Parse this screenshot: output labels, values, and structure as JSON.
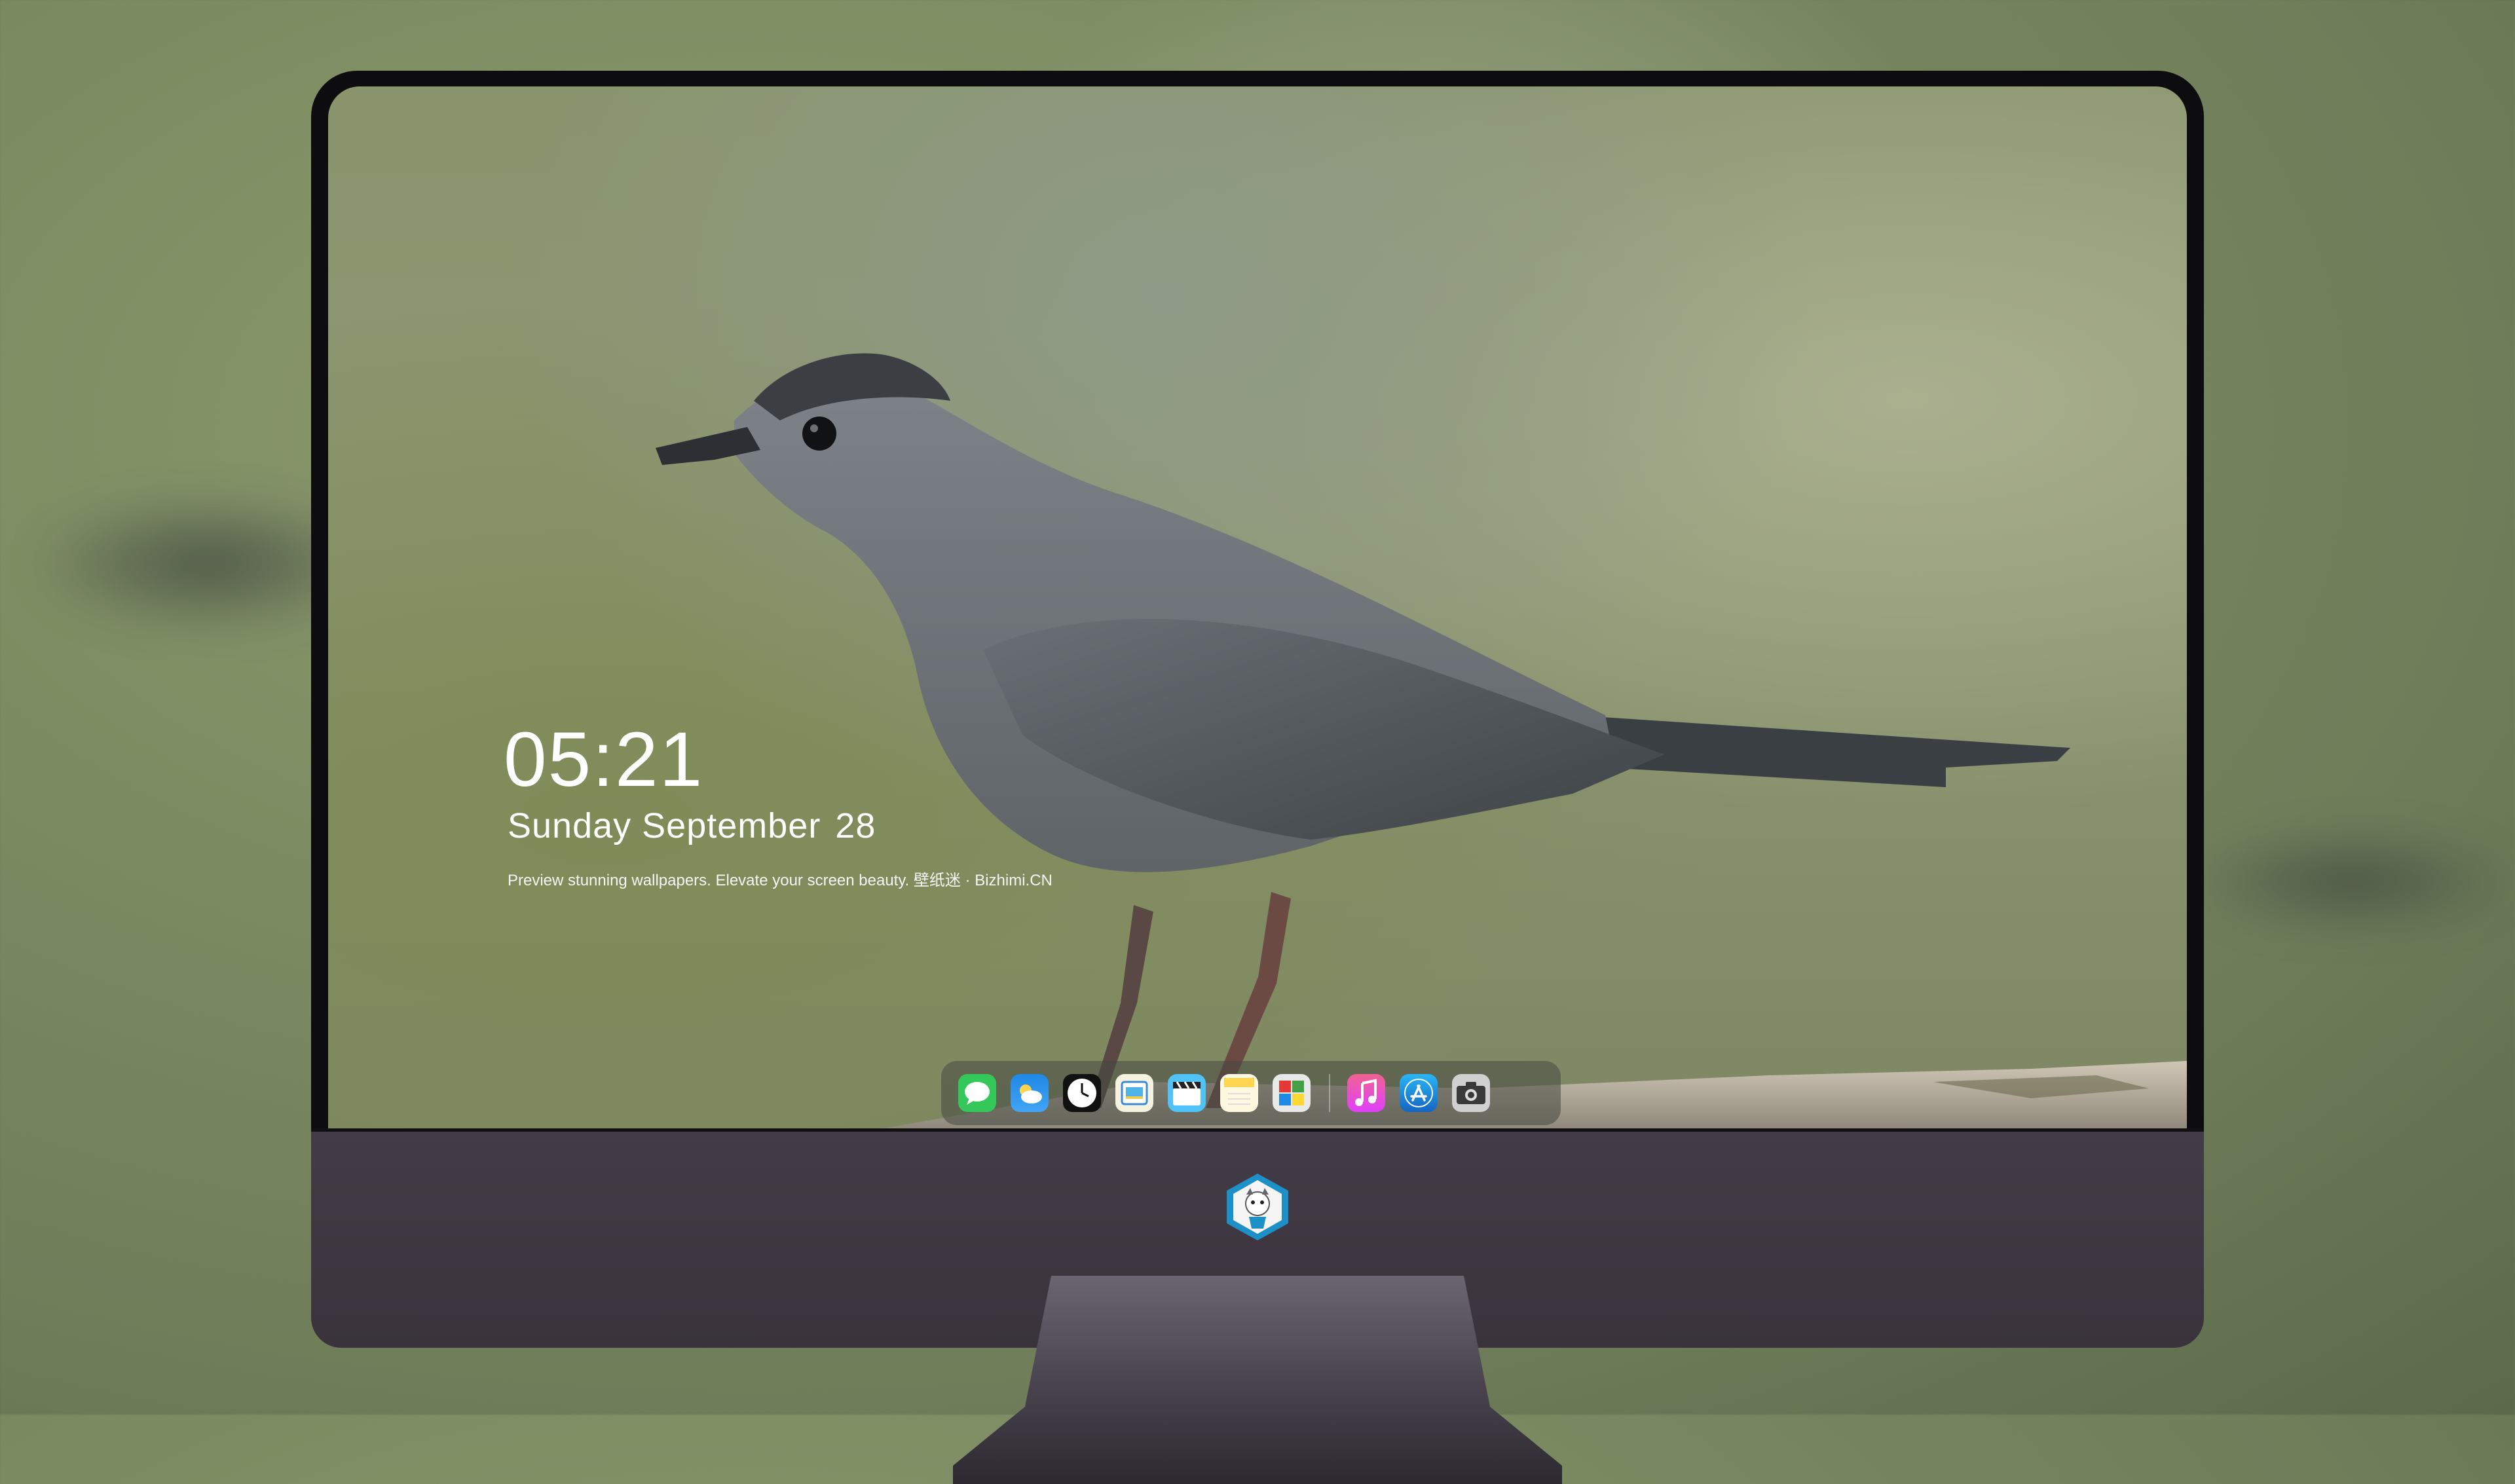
{
  "lockscreen": {
    "time": "05:21",
    "day_month": "Sunday September",
    "day_number": "28",
    "tagline": "Preview stunning wallpapers. Elevate your screen beauty. 壁纸迷 · Bizhimi.CN"
  },
  "dock": {
    "apps": [
      {
        "name": "Messages",
        "icon": "messages-icon",
        "color": "#34c759"
      },
      {
        "name": "Weather",
        "icon": "weather-icon",
        "color": "#1e88e5"
      },
      {
        "name": "Clock",
        "icon": "clock-icon",
        "color": "#111111"
      },
      {
        "name": "Preview",
        "icon": "preview-icon",
        "color": "#f2c94c"
      },
      {
        "name": "Clips",
        "icon": "clapperboard-icon",
        "color": "#4fc3f7"
      },
      {
        "name": "Notes",
        "icon": "notes-icon",
        "color": "#ffd54f"
      },
      {
        "name": "Photo Booth",
        "icon": "photo-grid-icon",
        "color": "#e0e0e0"
      },
      {
        "name": "iTunes",
        "icon": "music-icon",
        "color": "#e040fb"
      },
      {
        "name": "App Store",
        "icon": "app-store-icon",
        "color": "#1e88e5"
      },
      {
        "name": "Camera",
        "icon": "camera-icon",
        "color": "#5f5f5f"
      }
    ]
  },
  "colors": {
    "bezel": "#0d0d0f",
    "chin": "#3f3741",
    "wallpaper_green": "#8a956e"
  }
}
